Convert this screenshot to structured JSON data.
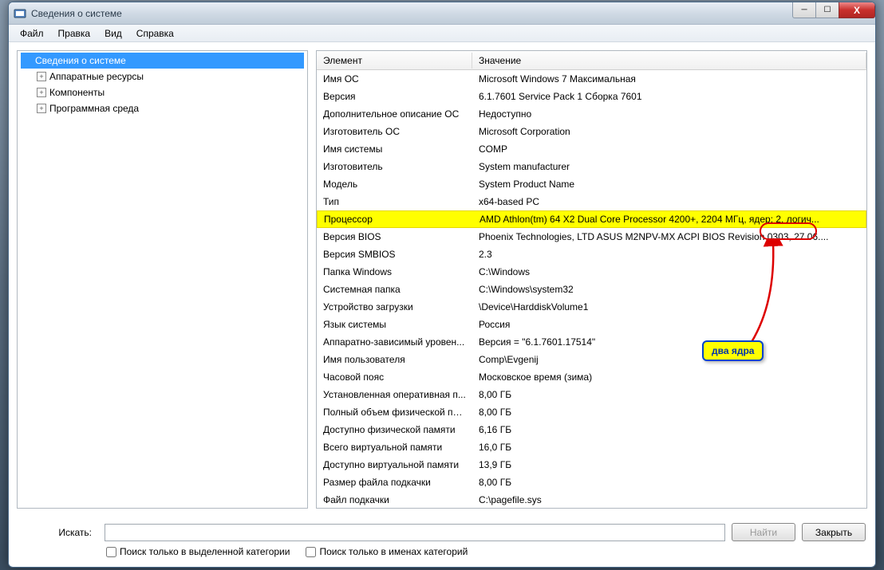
{
  "window": {
    "title": "Сведения о системе"
  },
  "menubar": {
    "items": [
      "Файл",
      "Правка",
      "Вид",
      "Справка"
    ]
  },
  "tree": {
    "root": "Сведения о системе",
    "children": [
      "Аппаратные ресурсы",
      "Компоненты",
      "Программная среда"
    ]
  },
  "details": {
    "columns": [
      "Элемент",
      "Значение"
    ],
    "rows": [
      {
        "el": "Имя ОС",
        "val": "Microsoft Windows 7 Максимальная",
        "hl": false
      },
      {
        "el": "Версия",
        "val": "6.1.7601 Service Pack 1 Сборка 7601",
        "hl": false
      },
      {
        "el": "Дополнительное описание ОС",
        "val": "Недоступно",
        "hl": false
      },
      {
        "el": "Изготовитель ОС",
        "val": "Microsoft Corporation",
        "hl": false
      },
      {
        "el": "Имя системы",
        "val": "COMP",
        "hl": false
      },
      {
        "el": "Изготовитель",
        "val": "System manufacturer",
        "hl": false
      },
      {
        "el": "Модель",
        "val": "System Product Name",
        "hl": false
      },
      {
        "el": "Тип",
        "val": "x64-based PC",
        "hl": false
      },
      {
        "el": "Процессор",
        "val": "AMD Athlon(tm) 64 X2 Dual Core Processor 4200+, 2204 МГц, ядер: 2, логич...",
        "hl": true
      },
      {
        "el": "Версия BIOS",
        "val": "Phoenix Technologies, LTD ASUS M2NPV-MX ACPI BIOS Revision 0303, 27.06....",
        "hl": false
      },
      {
        "el": "Версия SMBIOS",
        "val": "2.3",
        "hl": false
      },
      {
        "el": "Папка Windows",
        "val": "C:\\Windows",
        "hl": false
      },
      {
        "el": "Системная папка",
        "val": "C:\\Windows\\system32",
        "hl": false
      },
      {
        "el": "Устройство загрузки",
        "val": "\\Device\\HarddiskVolume1",
        "hl": false
      },
      {
        "el": "Язык системы",
        "val": "Россия",
        "hl": false
      },
      {
        "el": "Аппаратно-зависимый уровен...",
        "val": "Версия = \"6.1.7601.17514\"",
        "hl": false
      },
      {
        "el": "Имя пользователя",
        "val": "Comp\\Evgenij",
        "hl": false
      },
      {
        "el": "Часовой пояс",
        "val": "Московское время (зима)",
        "hl": false
      },
      {
        "el": "Установленная оперативная п...",
        "val": "8,00 ГБ",
        "hl": false
      },
      {
        "el": "Полный объем физической па...",
        "val": "8,00 ГБ",
        "hl": false
      },
      {
        "el": "Доступно физической памяти",
        "val": "6,16 ГБ",
        "hl": false
      },
      {
        "el": "Всего виртуальной памяти",
        "val": "16,0 ГБ",
        "hl": false
      },
      {
        "el": "Доступно виртуальной памяти",
        "val": "13,9 ГБ",
        "hl": false
      },
      {
        "el": "Размер файла подкачки",
        "val": "8,00 ГБ",
        "hl": false
      },
      {
        "el": "Файл подкачки",
        "val": "C:\\pagefile.sys",
        "hl": false
      }
    ]
  },
  "bottom": {
    "search_label": "Искать:",
    "find_btn": "Найти",
    "close_btn": "Закрыть",
    "check_selected": "Поиск только в выделенной категории",
    "check_names": "Поиск только в именах категорий"
  },
  "annotation": {
    "callout_text": "два ядра"
  }
}
